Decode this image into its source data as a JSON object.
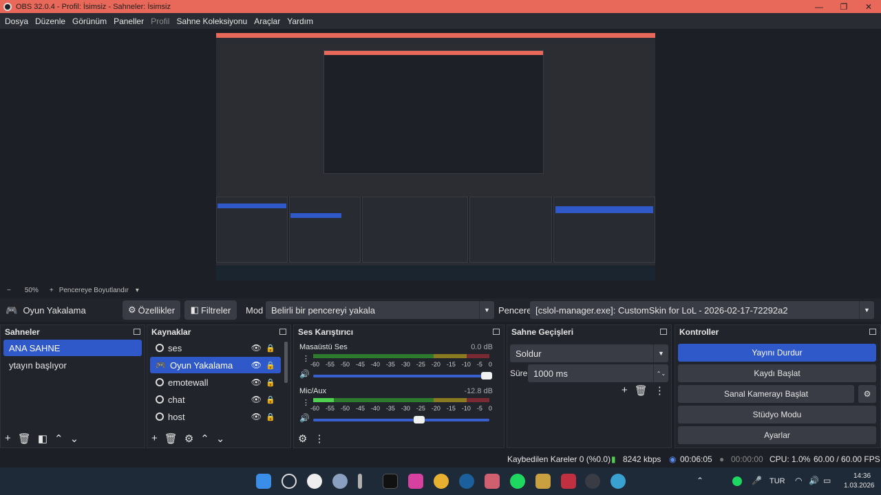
{
  "window": {
    "title": "OBS 32.0.4 - Profil: İsimsiz - Sahneler: İsimsiz"
  },
  "menu": [
    "Dosya",
    "Düzenle",
    "Görünüm",
    "Paneller",
    "Profil",
    "Sahne Koleksiyonu",
    "Araçlar",
    "Yardım"
  ],
  "zoom": {
    "minus": "−",
    "value": "50%",
    "plus": "+",
    "mode": "Pencereye Boyutlandır"
  },
  "context": {
    "source_name": "Oyun Yakalama",
    "properties_label": "Özellikler",
    "filters_label": "Filtreler",
    "mode_label": "Mod",
    "mode_value": "Belirli bir pencereyi yakala",
    "window_label": "Pencere",
    "window_value": "[cslol-manager.exe]: CustomSkin for LoL - 2026-02-17-72292a2"
  },
  "scenes": {
    "title": "Sahneler",
    "items": [
      "ANA SAHNE",
      "ytayın başlıyor"
    ]
  },
  "sources": {
    "title": "Kaynaklar",
    "items": [
      "ses",
      "Oyun Yakalama",
      "emotewall",
      "chat",
      "host"
    ]
  },
  "mixer": {
    "title": "Ses Karıştırıcı",
    "ticks": [
      "-60",
      "-55",
      "-50",
      "-45",
      "-40",
      "-35",
      "-30",
      "-25",
      "-20",
      "-15",
      "-10",
      "-5",
      "0"
    ],
    "channels": [
      {
        "name": "Masaüstü Ses",
        "db": "0.0 dB",
        "level": 0.0,
        "volume": 1.0
      },
      {
        "name": "Mic/Aux",
        "db": "-12.8 dB",
        "level": 0.12,
        "volume": 0.6
      }
    ]
  },
  "transitions": {
    "title": "Sahne Geçişleri",
    "type": "Soldur",
    "duration_label": "Süre",
    "duration_value": "1000 ms"
  },
  "controls": {
    "title": "Kontroller",
    "stream": "Yayını Durdur",
    "record": "Kaydı Başlat",
    "vcam": "Sanal Kamerayı Başlat",
    "studio": "Stüdyo Modu",
    "settings": "Ayarlar"
  },
  "status": {
    "dropped": "Kaybedilen Kareler 0 (%0.0)",
    "bitrate": "8242 kbps",
    "stream_time": "00:06:05",
    "rec_time": "00:00:00",
    "cpu": "CPU: 1.0%",
    "fps": "60.00 / 60.00 FPS"
  },
  "tray": {
    "lang": "TUR",
    "time": "14:36",
    "date": "1.03.2026"
  },
  "colors": {
    "accent": "#2f58c9",
    "titlebar": "#e8685a",
    "panel": "#22242b"
  }
}
